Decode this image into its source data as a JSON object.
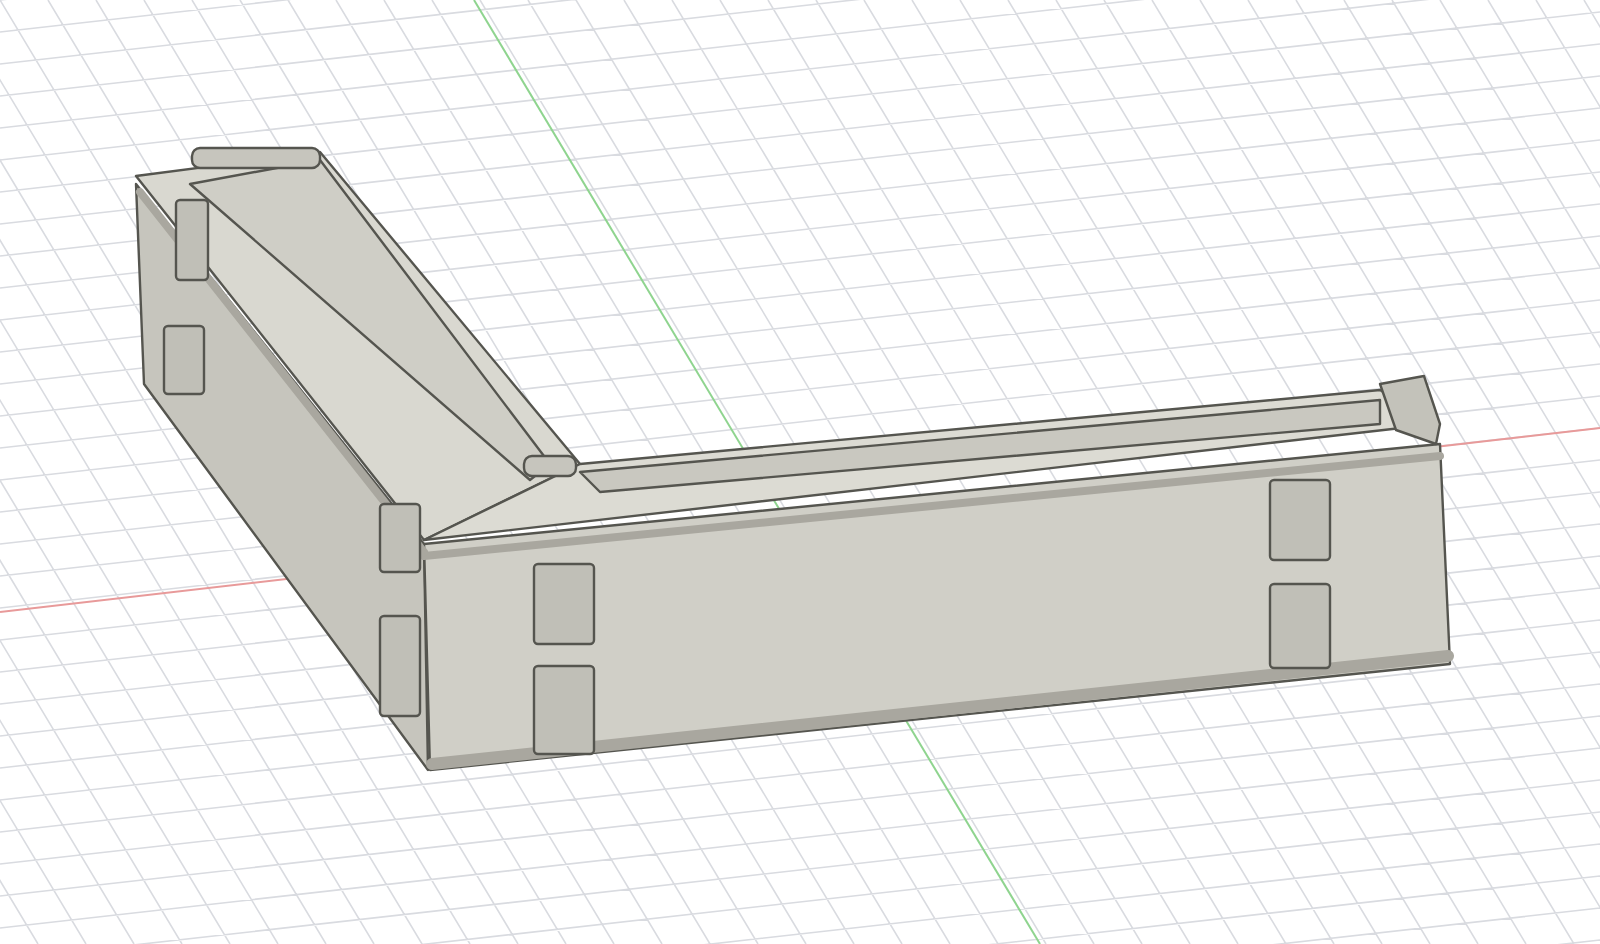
{
  "viewport": {
    "grid_visible": true,
    "axes_visible": true
  }
}
